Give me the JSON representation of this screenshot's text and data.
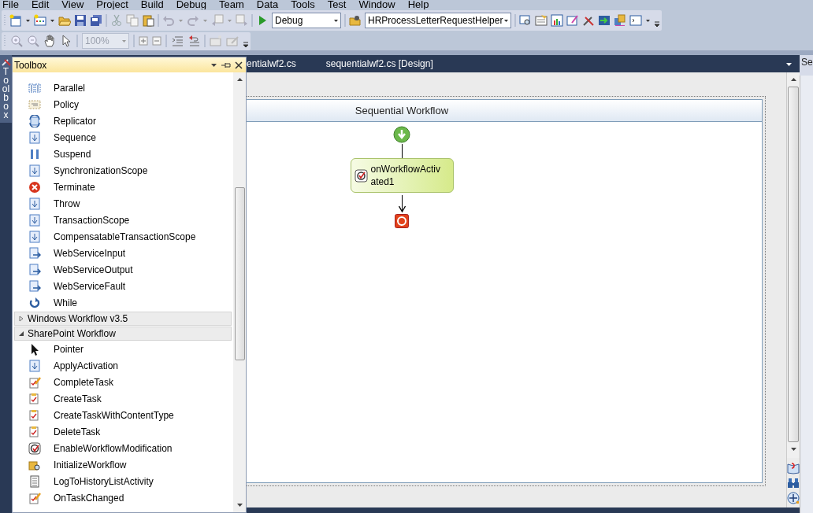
{
  "menu": [
    "File",
    "Edit",
    "View",
    "Project",
    "Build",
    "Debug",
    "Team",
    "Data",
    "Tools",
    "Test",
    "Window",
    "Help"
  ],
  "toolbar": {
    "configuration": "Debug",
    "startup_item": "HRProcessLetterRequestHelper",
    "zoom": {
      "value": "100%",
      "disabled": true
    }
  },
  "side_tabs": {
    "left": "Toolbox",
    "right": "Se"
  },
  "toolbox": {
    "title": "Toolbox",
    "items": [
      {
        "label": "Parallel"
      },
      {
        "label": "Policy"
      },
      {
        "label": "Replicator"
      },
      {
        "label": "Sequence"
      },
      {
        "label": "Suspend"
      },
      {
        "label": "SynchronizationScope"
      },
      {
        "label": "Terminate"
      },
      {
        "label": "Throw"
      },
      {
        "label": "TransactionScope"
      },
      {
        "label": "CompensatableTransactionScope"
      },
      {
        "label": "WebServiceInput"
      },
      {
        "label": "WebServiceOutput"
      },
      {
        "label": "WebServiceFault"
      },
      {
        "label": "While"
      }
    ],
    "categories": [
      {
        "label": "Windows Workflow v3.5",
        "expanded": false
      },
      {
        "label": "SharePoint Workflow",
        "expanded": true,
        "children": [
          {
            "label": "Pointer"
          },
          {
            "label": "ApplyActivation"
          },
          {
            "label": "CompleteTask"
          },
          {
            "label": "CreateTask"
          },
          {
            "label": "CreateTaskWithContentType"
          },
          {
            "label": "DeleteTask"
          },
          {
            "label": "EnableWorkflowModification"
          },
          {
            "label": "InitializeWorkflow"
          },
          {
            "label": "LogToHistoryListActivity"
          },
          {
            "label": "OnTaskChanged"
          }
        ]
      }
    ]
  },
  "tabs": [
    {
      "label": "entialwf2.cs"
    },
    {
      "label": "sequentialwf2.cs [Design]"
    }
  ],
  "designer": {
    "title": "Sequential Workflow",
    "activity": "onWorkflowActivated1"
  }
}
